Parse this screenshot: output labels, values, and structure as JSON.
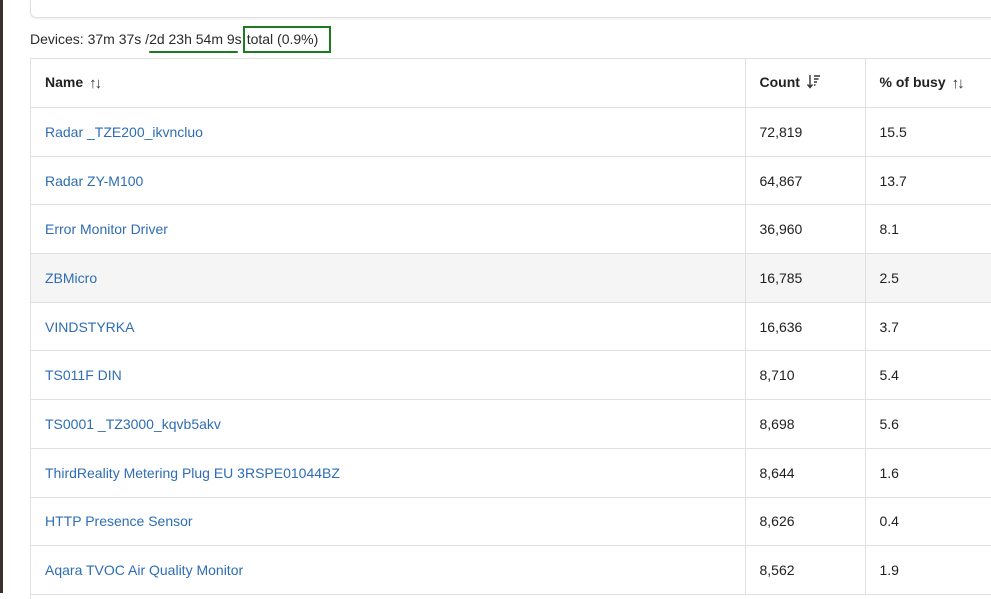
{
  "summary": {
    "prefix": "Devices: 37m 37s / ",
    "uptime": "2d 23h 54m 9s",
    "total": "total (0.9%)"
  },
  "table": {
    "columns": [
      {
        "label": "Name",
        "sort": "unsorted"
      },
      {
        "label": "Count",
        "sort": "descending"
      },
      {
        "label": "% of busy",
        "sort": "unsorted"
      }
    ],
    "rows": [
      {
        "name": "Radar _TZE200_ikvncluo",
        "count": "72,819",
        "busy": "15.5"
      },
      {
        "name": "Radar ZY-M100",
        "count": "64,867",
        "busy": "13.7"
      },
      {
        "name": "Error Monitor Driver",
        "count": "36,960",
        "busy": "8.1"
      },
      {
        "name": "ZBMicro",
        "count": "16,785",
        "busy": "2.5"
      },
      {
        "name": "VINDSTYRKA",
        "count": "16,636",
        "busy": "3.7"
      },
      {
        "name": "TS011F DIN",
        "count": "8,710",
        "busy": "5.4"
      },
      {
        "name": "TS0001 _TZ3000_kqvb5akv",
        "count": "8,698",
        "busy": "5.6"
      },
      {
        "name": "ThirdReality Metering Plug EU 3RSPE01044BZ",
        "count": "8,644",
        "busy": "1.6"
      },
      {
        "name": "HTTP Presence Sensor",
        "count": "8,626",
        "busy": "0.4"
      },
      {
        "name": "Aqara TVOC Air Quality Monitor",
        "count": "8,562",
        "busy": "1.9"
      }
    ]
  },
  "colors": {
    "link": "#2e6db4",
    "annotation": "#1e7a1e",
    "row_hover": "#f5f5f5"
  },
  "icons": {
    "unsorted": "sort-arrows-icon",
    "descending": "sort-descending-icon"
  }
}
